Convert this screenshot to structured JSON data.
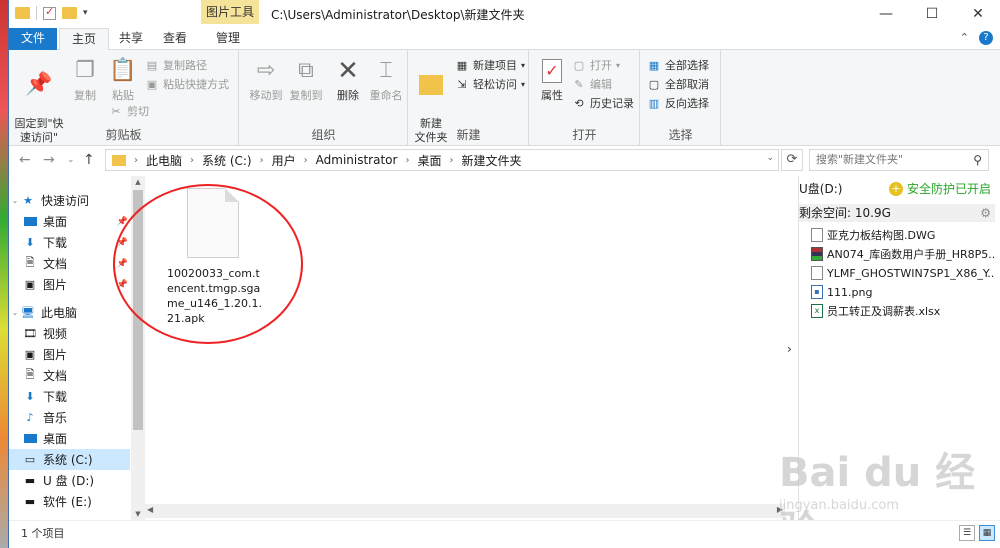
{
  "window": {
    "path_title": "C:\\Users\\Administrator\\Desktop\\新建文件夹",
    "context_tab": "图片工具",
    "controls": {
      "minimize": "—",
      "maximize": "☐",
      "close": "✕"
    }
  },
  "tabs": {
    "file": "文件",
    "home": "主页",
    "share": "共享",
    "view": "查看",
    "manage": "管理"
  },
  "ribbon": {
    "clipboard": {
      "label": "剪贴板",
      "pin": "固定到\"快\n速访问\"",
      "copy": "复制",
      "paste": "粘贴",
      "copy_path": "复制路径",
      "paste_shortcut": "粘贴快捷方式",
      "cut": "剪切"
    },
    "organize": {
      "label": "组织",
      "move_to": "移动到",
      "copy_to": "复制到",
      "delete": "删除",
      "rename": "重命名"
    },
    "new": {
      "label": "新建",
      "new_folder": "新建\n文件夹",
      "new_item": "新建项目",
      "easy_access": "轻松访问"
    },
    "open": {
      "label": "打开",
      "properties": "属性",
      "open": "打开",
      "edit": "编辑",
      "history": "历史记录"
    },
    "select": {
      "label": "选择",
      "select_all": "全部选择",
      "select_none": "全部取消",
      "invert": "反向选择"
    }
  },
  "address": {
    "crumbs": [
      "此电脑",
      "系统 (C:)",
      "用户",
      "Administrator",
      "桌面",
      "新建文件夹"
    ],
    "search_placeholder": "搜索\"新建文件夹\""
  },
  "navpane": {
    "quick_access": "快速访问",
    "quick_items": [
      "桌面",
      "下载",
      "文档",
      "图片"
    ],
    "this_pc": "此电脑",
    "pc_items": [
      "视频",
      "图片",
      "文档",
      "下载",
      "音乐",
      "桌面",
      "系统 (C:)",
      "U 盘 (D:)",
      "软件 (E:)"
    ]
  },
  "content": {
    "files": [
      {
        "name": "10020033_com.tencent.tmgp.sgame_u146_1.20.1.21.apk"
      }
    ]
  },
  "rightpane": {
    "drive": "U盘(D:)",
    "safe": "安全防护已开启",
    "free": "剩余空间: 10.9G",
    "items": [
      {
        "name": "亚克力板结构图.DWG",
        "icon": "dwg-file-icon"
      },
      {
        "name": "AN074_库函数用户手册_HR8P5...",
        "icon": "rar-file-icon"
      },
      {
        "name": "YLMF_GHOSTWIN7SP1_X86_Y...",
        "icon": "iso-file-icon"
      },
      {
        "name": "111.png",
        "icon": "png-file-icon"
      },
      {
        "name": "员工转正及调薪表.xlsx",
        "icon": "xlsx-file-icon"
      }
    ]
  },
  "status": {
    "count": "1 个项目"
  },
  "watermark": {
    "brand": "Bai du 经验",
    "url": "jingyan.baidu.com"
  },
  "colors": {
    "accent": "#1979ca",
    "context_tab": "#f6e39a",
    "annotation": "#e22222",
    "safe_green": "#2aa52a"
  }
}
